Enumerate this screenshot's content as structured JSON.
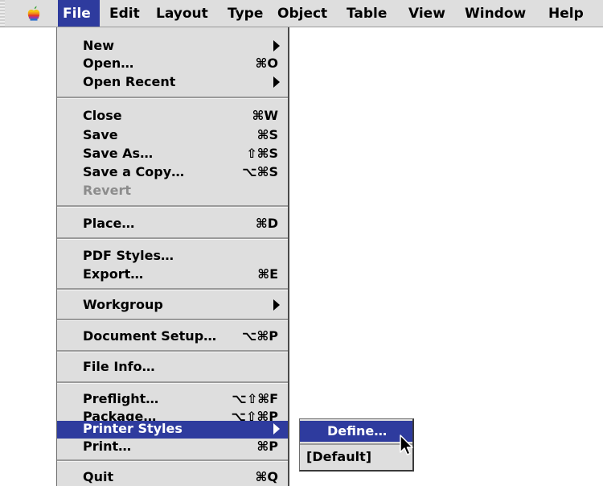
{
  "menubar": {
    "apple_menu_icon": "apple-icon",
    "items": [
      {
        "label": "File",
        "active": true
      },
      {
        "label": "Edit"
      },
      {
        "label": "Layout"
      },
      {
        "label": "Type"
      },
      {
        "label": "Object"
      },
      {
        "label": "Table"
      },
      {
        "label": "View"
      },
      {
        "label": "Window"
      },
      {
        "label": "Help"
      }
    ]
  },
  "file_menu": {
    "items": [
      {
        "label": "New",
        "submenu": true
      },
      {
        "label": "Open…",
        "shortcut": "⌘O"
      },
      {
        "label": "Open Recent",
        "submenu": true
      },
      {
        "label": "Close",
        "shortcut": "⌘W"
      },
      {
        "label": "Save",
        "shortcut": "⌘S"
      },
      {
        "label": "Save As…",
        "shortcut": "⇧⌘S"
      },
      {
        "label": "Save a Copy…",
        "shortcut": "⌥⌘S"
      },
      {
        "label": "Revert",
        "disabled": true
      },
      {
        "label": "Place…",
        "shortcut": "⌘D"
      },
      {
        "label": "PDF Styles…"
      },
      {
        "label": "Export…",
        "shortcut": "⌘E"
      },
      {
        "label": "Workgroup",
        "submenu": true
      },
      {
        "label": "Document Setup…",
        "shortcut": "⌥⌘P"
      },
      {
        "label": "File Info…"
      },
      {
        "label": "Preflight…",
        "shortcut": "⌥⇧⌘F"
      },
      {
        "label": "Package…",
        "shortcut": "⌥⇧⌘P"
      },
      {
        "label": "Printer Styles",
        "submenu": true,
        "highlighted": true
      },
      {
        "label": "Print…",
        "shortcut": "⌘P"
      },
      {
        "label": "Quit",
        "shortcut": "⌘Q"
      }
    ]
  },
  "printer_styles_submenu": {
    "items": [
      {
        "label": "Define…",
        "highlighted": true
      },
      {
        "label": "[Default]"
      }
    ]
  },
  "colors": {
    "menu_background": "#dedede",
    "highlight": "#2e3b9e",
    "disabled_text": "#8c8c8c"
  }
}
